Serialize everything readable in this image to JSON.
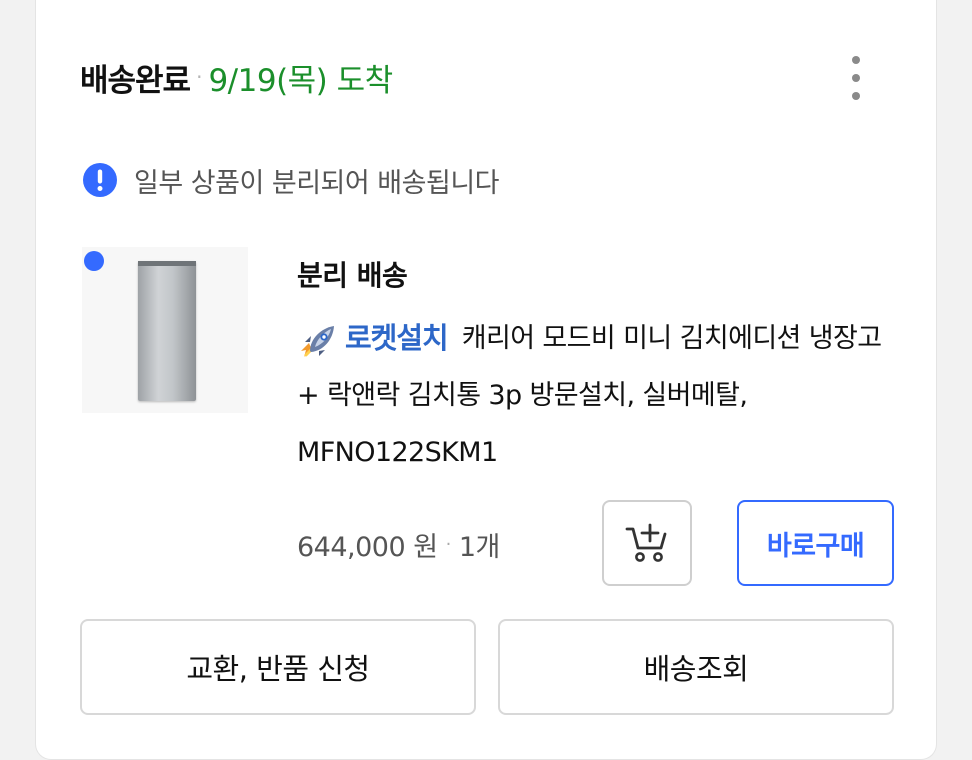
{
  "order": {
    "status": "배송완료",
    "separator": "·",
    "arrival": "9/19(목) 도착",
    "more_icon": "more-vertical-icon"
  },
  "notice": {
    "icon": "exclamation-circle-icon",
    "text": "일부 상품이 분리되어 배송됩니다"
  },
  "shipment": {
    "title": "분리 배송",
    "badge_label": "로켓설치",
    "badge_icon": "rocket-icon",
    "product_name": "캐리어 모드비 미니 김치에디션 냉장고 + 락앤락 김치통 3p 방문설치, 실버메탈, MFNO122SKM1",
    "price": "644,000 원",
    "separator": "·",
    "quantity": "1개"
  },
  "actions": {
    "cart_icon": "add-to-cart-icon",
    "buy_now": "바로구매",
    "exchange_return": "교환, 반품 신청",
    "track_delivery": "배송조회"
  },
  "colors": {
    "arrival_green": "#1b8f2b",
    "accent_blue": "#346aff",
    "rocket_blue": "#2d67c8"
  }
}
